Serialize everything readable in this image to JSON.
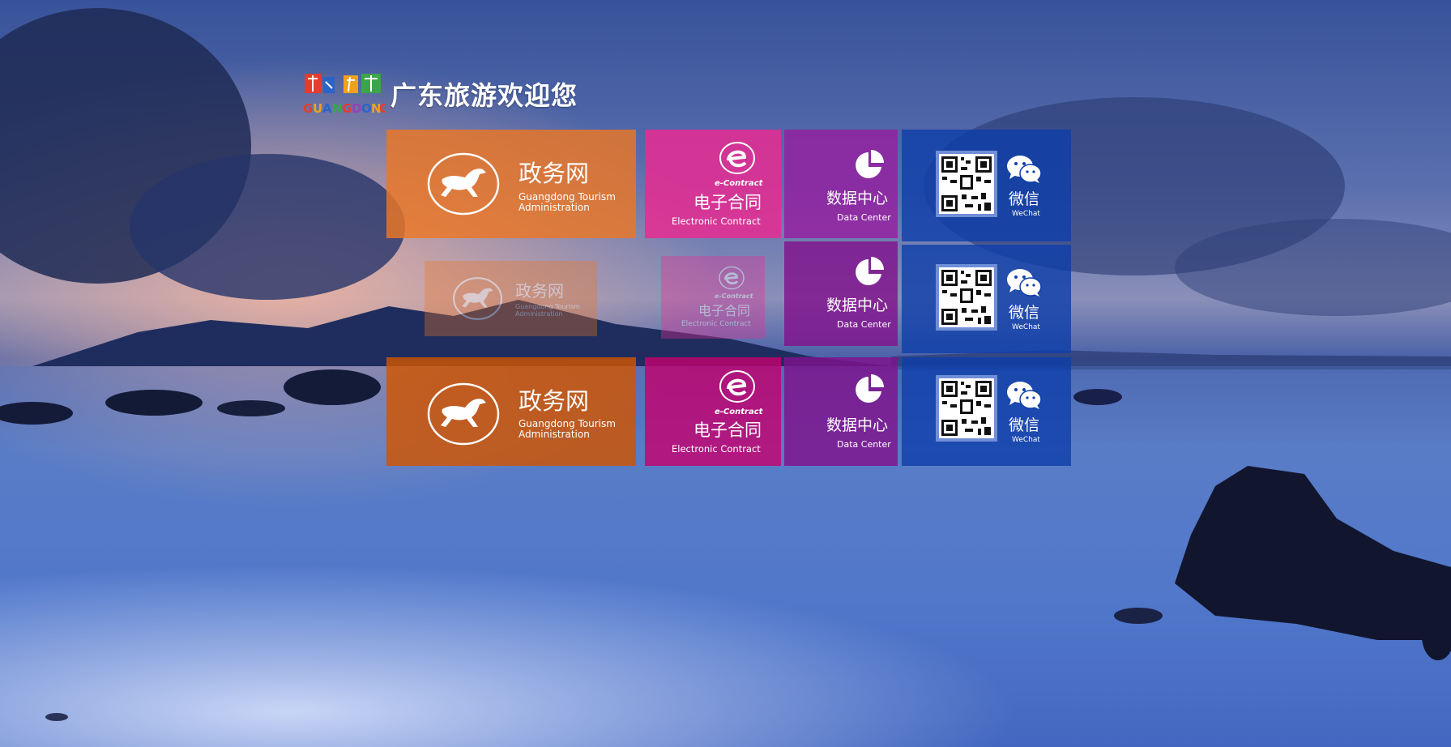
{
  "header": {
    "logo_text": "活力广东 GUANGDONG",
    "title": "广东旅游欢迎您"
  },
  "tiles": {
    "gov": {
      "cn": "政务网",
      "en_line1": "Guangdong Tourism",
      "en_line2": "Administration"
    },
    "econtract": {
      "brand": "e-Contract",
      "cn": "电子合同",
      "en": "Electronic Contract"
    },
    "datacenter": {
      "cn": "数据中心",
      "en": "Data Center"
    },
    "wechat": {
      "cn": "微信",
      "en": "WeChat"
    }
  },
  "colors": {
    "orange": "#ec7624",
    "pink": "#e92c92",
    "purple": "#961ea0",
    "blue": "#0e3eaa"
  }
}
